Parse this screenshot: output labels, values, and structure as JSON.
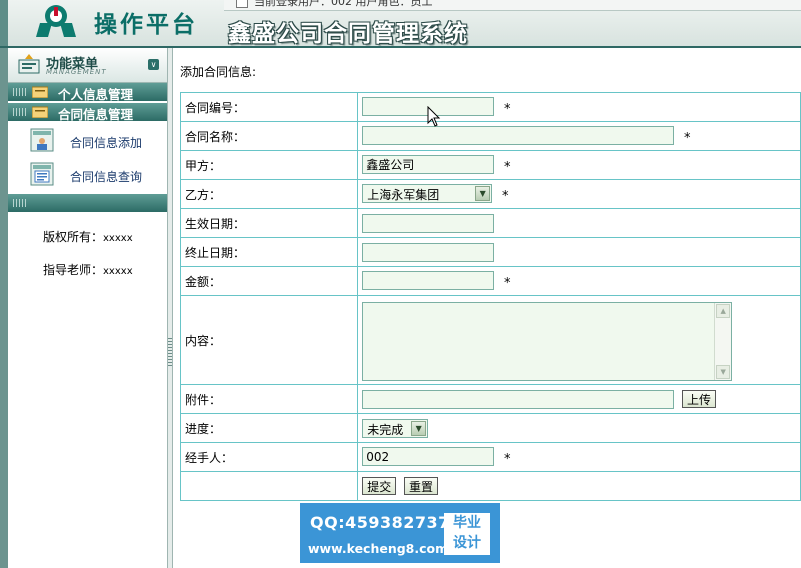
{
  "header": {
    "platform_title": "操作平台",
    "system_title": "鑫盛公司合同管理系统",
    "topbar_text": "当前登录用户：002 用户角色：员工"
  },
  "sidebar": {
    "menu_title": "功能菜单",
    "menu_subtitle": "MANAGEMENT",
    "groups": [
      {
        "label": "个人信息管理"
      },
      {
        "label": "合同信息管理"
      }
    ],
    "items": [
      {
        "label": "合同信息添加",
        "icon": "contract-add-icon"
      },
      {
        "label": "合同信息查询",
        "icon": "contract-query-icon"
      }
    ],
    "copyright_label": "版权所有：",
    "copyright_value": "xxxxx",
    "teacher_label": "指导老师：",
    "teacher_value": "xxxxx"
  },
  "form": {
    "caption": "添加合同信息:",
    "labels": {
      "contract_no": "合同编号：",
      "contract_name": "合同名称：",
      "party_a": "甲方：",
      "party_b": "乙方：",
      "start_date": "生效日期：",
      "end_date": "终止日期：",
      "amount": "金额：",
      "content": "内容：",
      "attachment": "附件：",
      "progress": "进度：",
      "handler": "经手人："
    },
    "values": {
      "contract_no": "",
      "contract_name": "",
      "party_a": "鑫盛公司",
      "party_b": "上海永军集团",
      "start_date": "",
      "end_date": "",
      "amount": "",
      "content": "",
      "attachment": "",
      "progress": "未完成",
      "handler": "002"
    },
    "required_mark": "*",
    "upload_label": "上传",
    "submit_label": "提交",
    "reset_label": "重置"
  },
  "watermark": {
    "qq": "QQ:459382737",
    "site": "www.kecheng8.com",
    "badge_line1": "毕业",
    "badge_line2": "设计"
  },
  "colors": {
    "brand_teal": "#2c6b65",
    "table_border": "#67c4c7",
    "input_bg": "#f0f9ee",
    "watermark_blue": "#3b95d6"
  }
}
